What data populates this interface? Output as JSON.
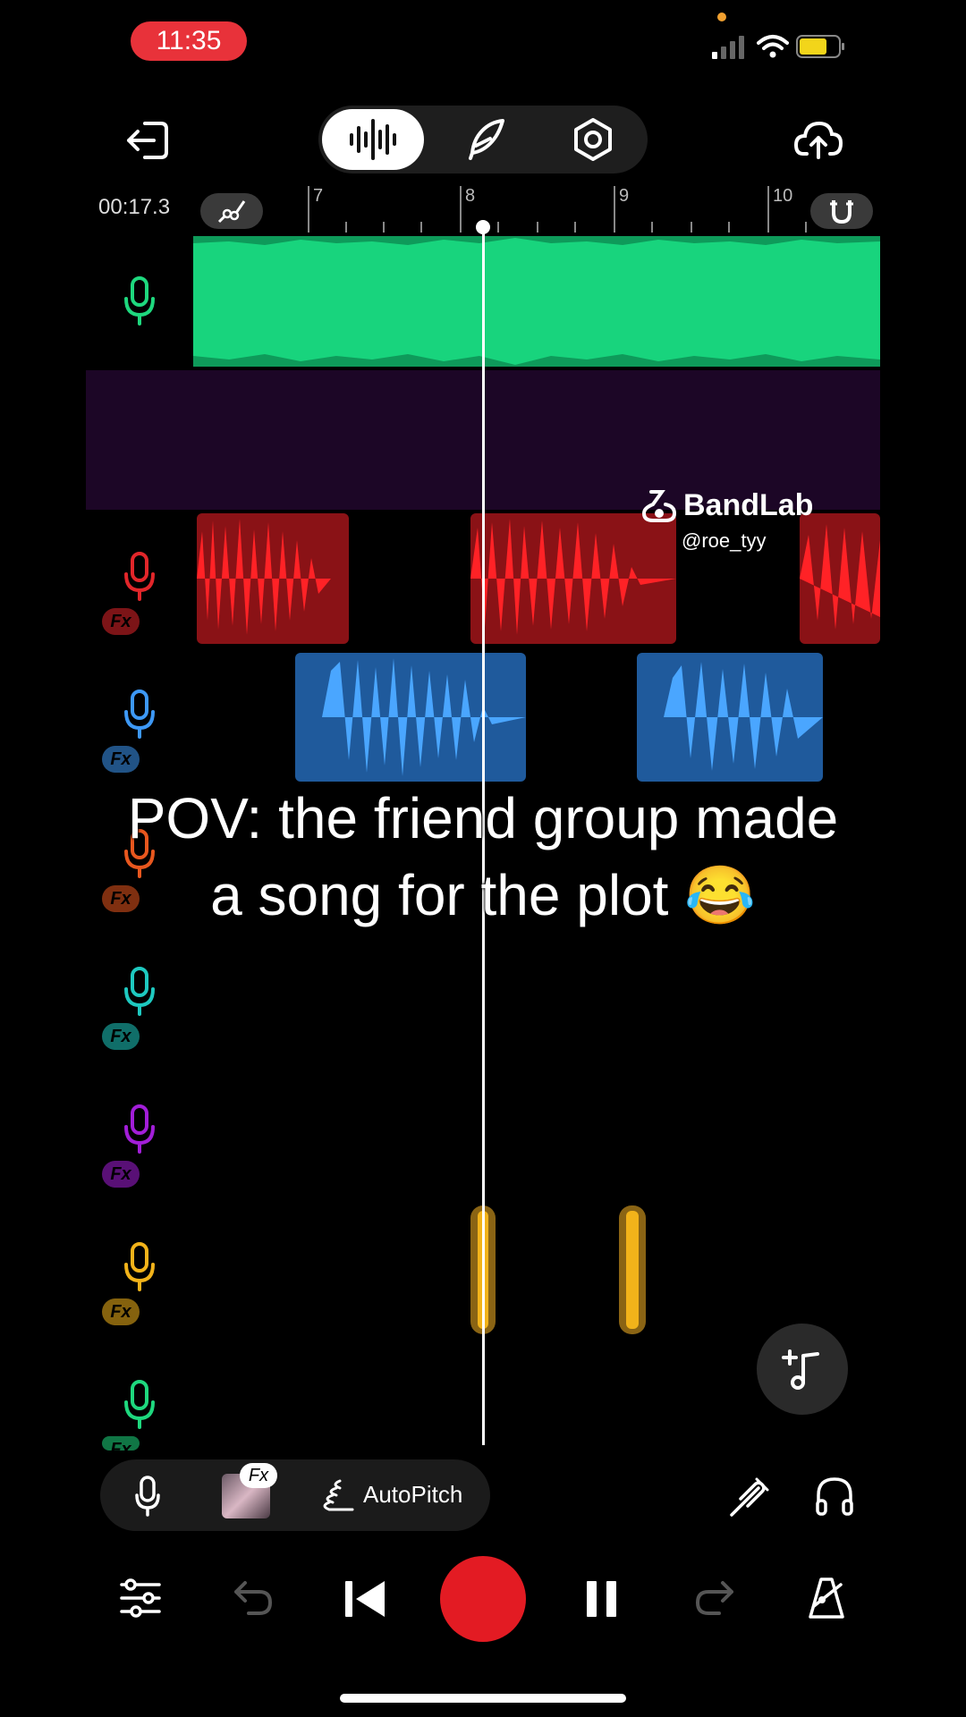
{
  "status_bar": {
    "time": "11:35"
  },
  "toolbar": {
    "back": "exit-icon",
    "modes": [
      "waveform-icon",
      "quill-icon",
      "settings-hex-icon"
    ],
    "upload": "cloud-upload-icon"
  },
  "ruler": {
    "timecode": "00:17.3",
    "labels": [
      "7",
      "8",
      "9",
      "10"
    ]
  },
  "tracks": [
    {
      "color": "#1ed87e",
      "fx": false
    },
    {
      "color": "#a21ed8",
      "fx": true
    },
    {
      "color": "#e2262a",
      "fx": true
    },
    {
      "color": "#3d98f5",
      "fx": true
    },
    {
      "color": "#e8571e",
      "fx": true
    },
    {
      "color": "#1ec9c0",
      "fx": true
    },
    {
      "color": "#a21ed8",
      "fx": true
    },
    {
      "color": "#f2b31a",
      "fx": true
    },
    {
      "color": "#1ed87e",
      "fx": true
    }
  ],
  "fx_label": "Fx",
  "watermark": {
    "brand": "BandLab",
    "user": "@roe_tyy"
  },
  "overlay_text": {
    "line1": "POV: the friend group made",
    "line2": "a song for the plot 😂"
  },
  "bottom_tools": {
    "fx_badge": "Fx",
    "autopitch_label": "AutoPitch"
  },
  "transport": [
    "mixer-icon",
    "undo-icon",
    "skip-back-icon",
    "record-button",
    "pause-icon",
    "redo-icon",
    "metronome-icon"
  ]
}
